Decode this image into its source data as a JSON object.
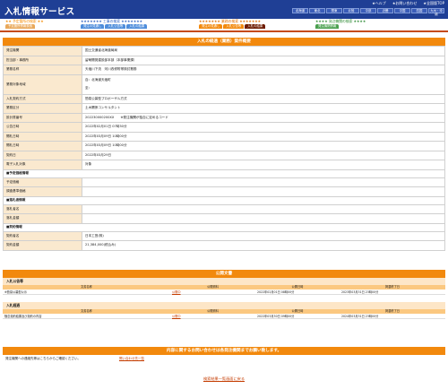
{
  "header": {
    "title": "入札情報サービス",
    "toplinks": [
      "★ヘルプ",
      "★お問い合わせ",
      "★全国版TOP"
    ],
    "regions": [
      "北海道",
      "東北",
      "関東",
      "北陸",
      "中部",
      "近畿",
      "中国",
      "四国",
      "九州・沖縄"
    ]
  },
  "nav": {
    "groups": [
      {
        "title": "★★ 予定箇所の検索 ★★",
        "color": "#f58a00",
        "tabs": [
          "予定箇所情報検索"
        ],
        "tab_colors": [
          "#e9a85a"
        ]
      },
      {
        "title": "★★★★★★★ 工事の検索 ★★★★★★★",
        "color": "#2b5fc0",
        "tabs": [
          "発注の見通し",
          "入札公告等",
          "入札の結果"
        ],
        "tab_colors": [
          "#4e8ddb",
          "#4e8ddb",
          "#4e8ddb"
        ]
      },
      {
        "title": "★★★★★★★ 業務の検索 ★★★★★★★",
        "color": "#e06e00",
        "tabs": [
          "発注の見通し",
          "入札公告等",
          "入札の結果"
        ],
        "tab_colors": [
          "#f2890d",
          "#f2890d",
          "#6e1c00"
        ]
      },
      {
        "title": "★★★★ 発注機関の検索 ★★★★",
        "color": "#2d8a33",
        "tabs": [
          "発注機関情報"
        ],
        "tab_colors": [
          "#4aa04f"
        ]
      }
    ]
  },
  "detail": {
    "heading": "入札の経過（業務）案件概要",
    "rows": [
      {
        "label": "発注機関",
        "value": "国土交通省北海道局局"
      },
      {
        "label": "担当部・事務所",
        "value": "留萌開発建設部本部（本部事業課）"
      },
      {
        "label": "業務名称",
        "value": "天塩川下流　河川改修附帯検討業務"
      },
      {
        "label": "業務対象地域",
        "value": "自：北海道天塩町\n至："
      },
      {
        "label": "入札契約方式",
        "value": "簡易公募型プロポーザル方式"
      },
      {
        "label": "業務区分",
        "value": "土木関係コンサルタント"
      },
      {
        "label": "設計書番号",
        "value": "202230000200XX　　※発注機関が独自に定めるコード"
      },
      {
        "label": "公告日時",
        "value": "2022年02月01日 07時30分"
      },
      {
        "label": "開札日時",
        "value": "2022年03月09日 10時00分"
      },
      {
        "label": "開札日時",
        "value": "2022年03月09日 10時00分"
      },
      {
        "label": "契約日",
        "value": "2022年03月29日"
      },
      {
        "label": "電子入札対象",
        "value": "対象"
      }
    ],
    "sec_plan": "■予定価格情報",
    "plan_rows": [
      {
        "label": "予定価格",
        "value": ""
      },
      {
        "label": "調査基準価格",
        "value": ""
      }
    ],
    "sec_fail": "■落札者情報",
    "fail_rows": [
      {
        "label": "落札者名",
        "value": ""
      },
      {
        "label": "落札金額",
        "value": ""
      }
    ],
    "sec_contract": "■契約情報",
    "contract_rows": [
      {
        "label": "契約者名",
        "value": "日本工営(株)"
      },
      {
        "label": "契約金額",
        "value": "21,384,000(税込み)"
      }
    ]
  },
  "notices": {
    "heading": "公開文書",
    "cols": [
      "文書名称",
      "公開資料",
      "公開日時",
      "掲載終了日"
    ],
    "sections": [
      {
        "title": "入札公告等",
        "rows": [
          {
            "name": "※簡易公募型公示",
            "link": "公開中",
            "date": "2022年02月01日 08時00分",
            "end": "2023年03月31日 23時00分"
          }
        ]
      },
      {
        "title": "入札経過",
        "rows": [
          {
            "name": "随意契約結果及び契約の内容",
            "link": "公開中",
            "date": "2022年03月30日 09時00分",
            "end": "2024年03月31日 23時00分"
          }
        ]
      }
    ]
  },
  "inquiry": {
    "heading": "内容に関するお問い合わせは各発注機関までお願い致します。",
    "text": "発注機関への連絡先等はこちらからご確認ください。",
    "link": "問い合わせ先一覧"
  },
  "footer": {
    "back": "検索結果一覧画面に戻る"
  }
}
